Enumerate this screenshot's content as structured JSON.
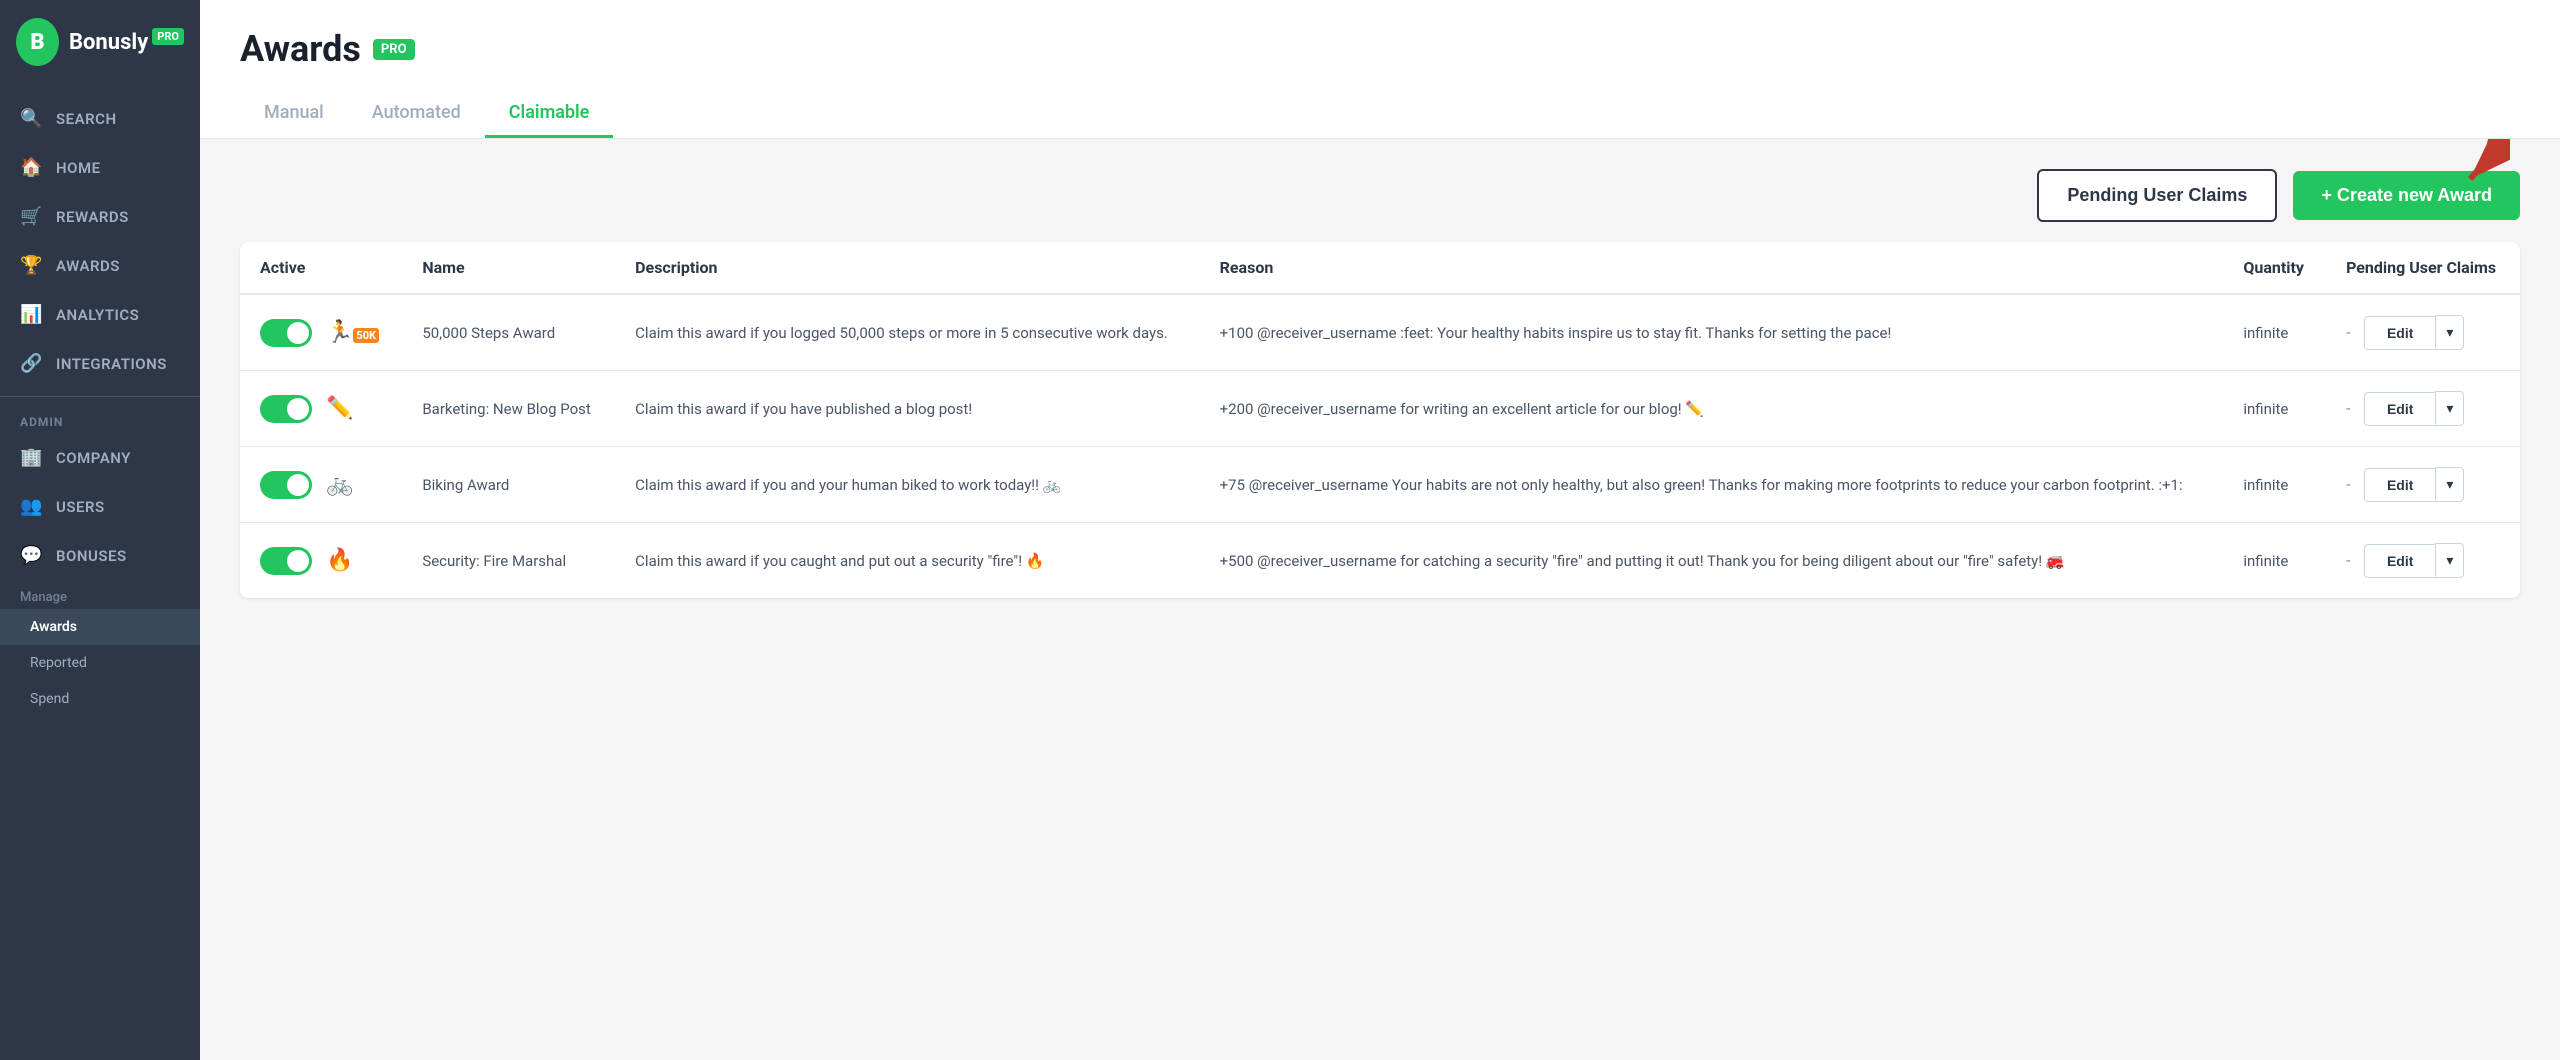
{
  "sidebar": {
    "logo": {
      "letter": "B",
      "name": "Bonusly",
      "pro": "PRO"
    },
    "nav_items": [
      {
        "id": "search",
        "label": "SEARCH",
        "icon": "🔍"
      },
      {
        "id": "home",
        "label": "HOME",
        "icon": "🏠"
      },
      {
        "id": "rewards",
        "label": "REWARDS",
        "icon": "🛒"
      },
      {
        "id": "awards",
        "label": "AWARDS",
        "icon": "🏆"
      },
      {
        "id": "analytics",
        "label": "ANALYTICS",
        "icon": "📊"
      },
      {
        "id": "integrations",
        "label": "INTEGRATIONS",
        "icon": "🔗"
      }
    ],
    "admin_label": "ADMIN",
    "admin_items": [
      {
        "id": "company",
        "label": "COMPANY",
        "icon": "🏢"
      },
      {
        "id": "users",
        "label": "USERS",
        "icon": "👥"
      },
      {
        "id": "bonuses",
        "label": "BONUSES",
        "icon": "💬"
      }
    ],
    "manage_label": "Manage",
    "sub_items": [
      {
        "id": "awards-sub",
        "label": "Awards",
        "active": true
      },
      {
        "id": "reported",
        "label": "Reported",
        "active": false
      },
      {
        "id": "spend",
        "label": "Spend",
        "active": false
      }
    ]
  },
  "header": {
    "title": "Awards",
    "pro_badge": "PRO",
    "tabs": [
      {
        "id": "manual",
        "label": "Manual",
        "active": false
      },
      {
        "id": "automated",
        "label": "Automated",
        "active": false
      },
      {
        "id": "claimable",
        "label": "Claimable",
        "active": true
      }
    ]
  },
  "toolbar": {
    "pending_btn": "Pending User Claims",
    "create_btn": "+ Create new Award"
  },
  "table": {
    "columns": [
      "Active",
      "Name",
      "Description",
      "Reason",
      "Quantity",
      "Pending User Claims"
    ],
    "rows": [
      {
        "active": true,
        "icon": "🏃",
        "icon_label": "50k",
        "name": "50,000 Steps Award",
        "description": "Claim this award if you logged 50,000 steps or more in 5 consecutive work days.",
        "reason": "+100 @receiver_username :feet: Your healthy habits inspire us to stay fit. Thanks for setting the pace!",
        "quantity": "infinite",
        "pending": "-"
      },
      {
        "active": true,
        "icon": "✏️",
        "icon_label": "pencil",
        "name": "Barketing: New Blog Post",
        "description": "Claim this award if you have published a blog post!",
        "reason": "+200 @receiver_username for writing an excellent article for our blog! ✏️",
        "quantity": "infinite",
        "pending": "-"
      },
      {
        "active": true,
        "icon": "🚲",
        "icon_label": "bike",
        "name": "Biking Award",
        "description": "Claim this award if you and your human biked to work today!! 🚲",
        "reason": "+75 @receiver_username Your habits are not only healthy, but also green! Thanks for making more footprints to reduce your carbon footprint. :+1:",
        "quantity": "infinite",
        "pending": "-"
      },
      {
        "active": true,
        "icon": "🔥",
        "icon_label": "fire",
        "name": "Security: Fire Marshal",
        "description": "Claim this award if you caught and put out a security \"fire\"! 🔥",
        "reason": "+500 @receiver_username for catching a security \"fire\" and putting it out! Thank you for being diligent about our \"fire\" safety! 🚒",
        "quantity": "infinite",
        "pending": "-"
      }
    ],
    "edit_label": "Edit"
  }
}
